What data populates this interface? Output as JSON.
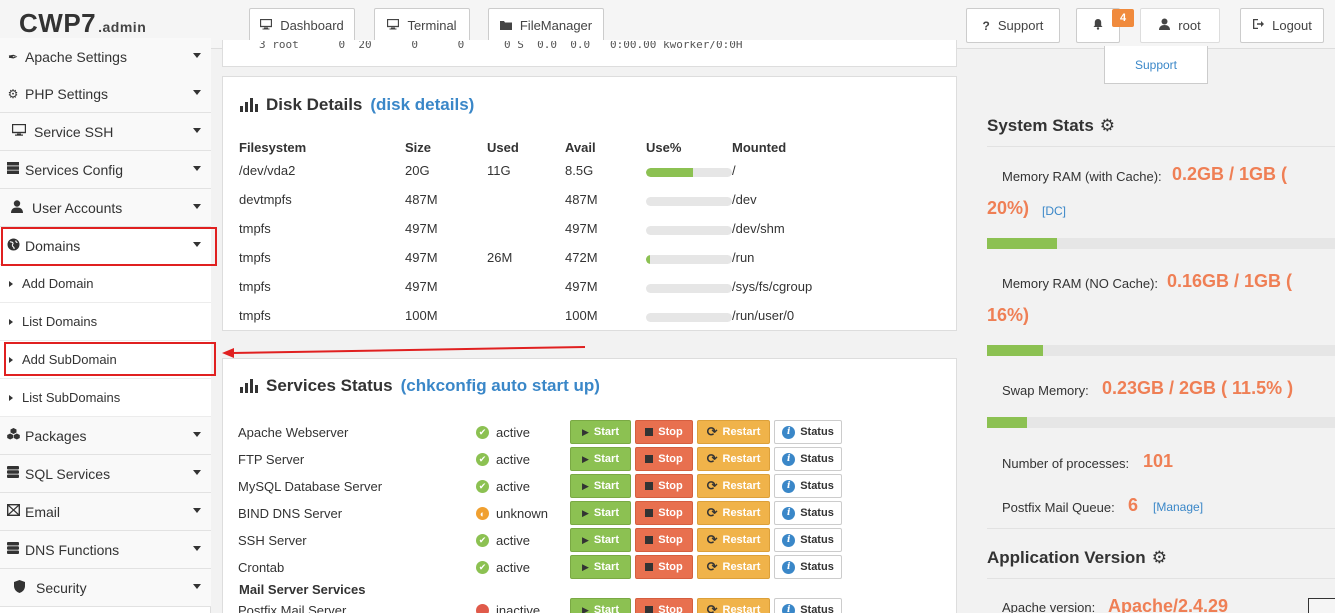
{
  "header": {
    "logo": "CWP7",
    "logo_suffix": ".admin",
    "buttons": {
      "dashboard": "Dashboard",
      "terminal": "Terminal",
      "filemanager": "FileManager",
      "support": "Support",
      "notifications_count": "4",
      "user": "root",
      "logout": "Logout"
    },
    "support_dropdown": "Support"
  },
  "sidebar": {
    "items": [
      {
        "label": "Apache Settings",
        "icon": "feather-icon"
      },
      {
        "label": "PHP Settings",
        "icon": "gear-icon"
      },
      {
        "label": "Service SSH",
        "icon": "monitor-icon"
      },
      {
        "label": "Services Config",
        "icon": "server-icon"
      },
      {
        "label": "User Accounts",
        "icon": "user-icon"
      },
      {
        "label": "Domains",
        "icon": "globe-icon"
      }
    ],
    "sub_items": [
      "Add Domain",
      "List Domains",
      "Add SubDomain",
      "List SubDomains"
    ],
    "items_after": [
      {
        "label": "Packages",
        "icon": "cubes-icon"
      },
      {
        "label": "SQL Services",
        "icon": "database-icon"
      },
      {
        "label": "Email",
        "icon": "envelope-icon"
      },
      {
        "label": "DNS Functions",
        "icon": "dns-icon"
      },
      {
        "label": "Security",
        "icon": "shield-icon"
      }
    ]
  },
  "process_line": "3 root      0  20      0      0      0 S  0.0  0.0   0:00.00 kworker/0:0H",
  "disk": {
    "title": "Disk Details",
    "link": "(disk details)",
    "headers": [
      "Filesystem",
      "Size",
      "Used",
      "Avail",
      "Use%",
      "Mounted"
    ],
    "rows": [
      {
        "fs": "/dev/vda2",
        "size": "20G",
        "used": "11G",
        "avail": "8.5G",
        "use_pct": 55,
        "mounted": "/"
      },
      {
        "fs": "devtmpfs",
        "size": "487M",
        "used": "",
        "avail": "487M",
        "use_pct": 0,
        "mounted": "/dev"
      },
      {
        "fs": "tmpfs",
        "size": "497M",
        "used": "",
        "avail": "497M",
        "use_pct": 0,
        "mounted": "/dev/shm"
      },
      {
        "fs": "tmpfs",
        "size": "497M",
        "used": "26M",
        "avail": "472M",
        "use_pct": 5,
        "mounted": "/run"
      },
      {
        "fs": "tmpfs",
        "size": "497M",
        "used": "",
        "avail": "497M",
        "use_pct": 0,
        "mounted": "/sys/fs/cgroup"
      },
      {
        "fs": "tmpfs",
        "size": "100M",
        "used": "",
        "avail": "100M",
        "use_pct": 0,
        "mounted": "/run/user/0"
      }
    ]
  },
  "services": {
    "title": "Services Status",
    "link": "(chkconfig auto start up)",
    "buttons": {
      "start": "Start",
      "stop": "Stop",
      "restart": "Restart",
      "status": "Status"
    },
    "rows": [
      {
        "name": "Apache Webserver",
        "state": "active",
        "kind": "ok"
      },
      {
        "name": "FTP Server",
        "state": "active",
        "kind": "ok"
      },
      {
        "name": "MySQL Database Server",
        "state": "active",
        "kind": "ok"
      },
      {
        "name": "BIND DNS Server",
        "state": "unknown",
        "kind": "warn"
      },
      {
        "name": "SSH Server",
        "state": "active",
        "kind": "ok"
      },
      {
        "name": "Crontab",
        "state": "active",
        "kind": "ok"
      }
    ],
    "mail_heading": "Mail Server Services",
    "mail_row": {
      "name": "Postfix Mail Server",
      "state": "inactive",
      "kind": "bad"
    }
  },
  "system_stats": {
    "title": "System Stats",
    "mem_cache_label": "Memory RAM (with Cache):",
    "mem_cache_value_a": "0.2GB / 1GB (",
    "mem_cache_value_b": "20%)",
    "mem_cache_link": "[DC]",
    "mem_cache_pct": 20,
    "mem_nocache_label": "Memory RAM (NO Cache):",
    "mem_nocache_value_a": "0.16GB / 1GB (",
    "mem_nocache_value_b": "16%)",
    "mem_nocache_pct": 16,
    "swap_label": "Swap Memory:",
    "swap_value": "0.23GB / 2GB ( 11.5% )",
    "swap_pct": 11.5,
    "processes_label": "Number of processes:",
    "processes_value": "101",
    "queue_label": "Postfix Mail Queue:",
    "queue_value": "6",
    "queue_link": "[Manage]"
  },
  "app_version": {
    "title": "Application Version",
    "apache_label": "Apache version:",
    "apache_value": "Apache/2.4.29"
  }
}
